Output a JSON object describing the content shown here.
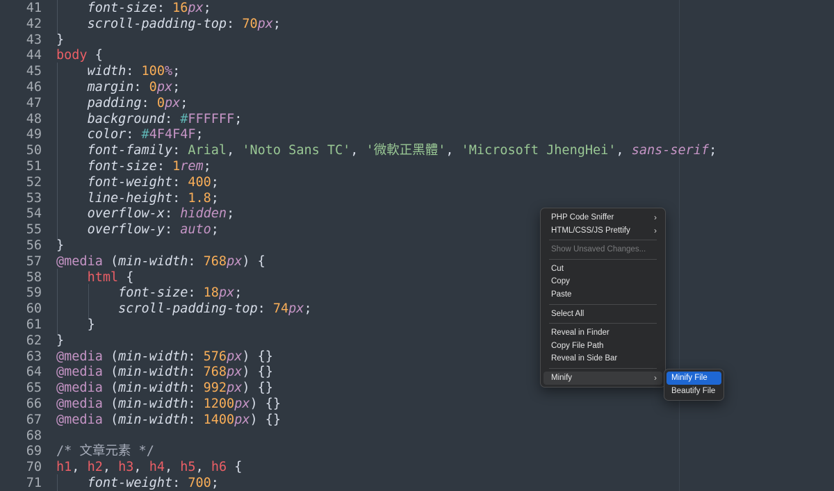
{
  "editor": {
    "lines": [
      {
        "n": "41",
        "segs": [
          [
            "guide",
            "    "
          ],
          [
            "prop",
            "font-size"
          ],
          [
            "punct",
            ": "
          ],
          [
            "num",
            "16"
          ],
          [
            "unit",
            "px"
          ],
          [
            "punct",
            ";"
          ]
        ]
      },
      {
        "n": "42",
        "segs": [
          [
            "guide",
            "    "
          ],
          [
            "prop",
            "scroll-padding-top"
          ],
          [
            "punct",
            ": "
          ],
          [
            "num",
            "70"
          ],
          [
            "unit",
            "px"
          ],
          [
            "punct",
            ";"
          ]
        ]
      },
      {
        "n": "43",
        "segs": [
          [
            "punct",
            "}"
          ]
        ]
      },
      {
        "n": "44",
        "segs": [
          [
            "sel",
            "body"
          ],
          [
            "punct",
            " {"
          ]
        ]
      },
      {
        "n": "45",
        "segs": [
          [
            "guide",
            "    "
          ],
          [
            "prop",
            "width"
          ],
          [
            "punct",
            ": "
          ],
          [
            "num",
            "100"
          ],
          [
            "unit",
            "%"
          ],
          [
            "punct",
            ";"
          ]
        ]
      },
      {
        "n": "46",
        "segs": [
          [
            "guide",
            "    "
          ],
          [
            "prop",
            "margin"
          ],
          [
            "punct",
            ": "
          ],
          [
            "num",
            "0"
          ],
          [
            "unit",
            "px"
          ],
          [
            "punct",
            ";"
          ]
        ]
      },
      {
        "n": "47",
        "segs": [
          [
            "guide",
            "    "
          ],
          [
            "prop",
            "padding"
          ],
          [
            "punct",
            ": "
          ],
          [
            "num",
            "0"
          ],
          [
            "unit",
            "px"
          ],
          [
            "punct",
            ";"
          ]
        ]
      },
      {
        "n": "48",
        "segs": [
          [
            "guide",
            "    "
          ],
          [
            "prop",
            "background"
          ],
          [
            "punct",
            ": "
          ],
          [
            "hash",
            "#"
          ],
          [
            "hex",
            "FFFFFF"
          ],
          [
            "punct",
            ";"
          ]
        ]
      },
      {
        "n": "49",
        "segs": [
          [
            "guide",
            "    "
          ],
          [
            "prop",
            "color"
          ],
          [
            "punct",
            ": "
          ],
          [
            "hash",
            "#"
          ],
          [
            "hex",
            "4F4F4F"
          ],
          [
            "punct",
            ";"
          ]
        ]
      },
      {
        "n": "50",
        "segs": [
          [
            "guide",
            "    "
          ],
          [
            "prop",
            "font-family"
          ],
          [
            "punct",
            ": "
          ],
          [
            "str",
            "Arial"
          ],
          [
            "punct",
            ", "
          ],
          [
            "str",
            "'Noto Sans TC'"
          ],
          [
            "punct",
            ", "
          ],
          [
            "str",
            "'微軟正黑體'"
          ],
          [
            "punct",
            ", "
          ],
          [
            "str",
            "'Microsoft JhengHei'"
          ],
          [
            "punct",
            ", "
          ],
          [
            "kw",
            "sans-serif"
          ],
          [
            "punct",
            ";"
          ]
        ]
      },
      {
        "n": "51",
        "segs": [
          [
            "guide",
            "    "
          ],
          [
            "prop",
            "font-size"
          ],
          [
            "punct",
            ": "
          ],
          [
            "num",
            "1"
          ],
          [
            "unit",
            "rem"
          ],
          [
            "punct",
            ";"
          ]
        ]
      },
      {
        "n": "52",
        "segs": [
          [
            "guide",
            "    "
          ],
          [
            "prop",
            "font-weight"
          ],
          [
            "punct",
            ": "
          ],
          [
            "num",
            "400"
          ],
          [
            "punct",
            ";"
          ]
        ]
      },
      {
        "n": "53",
        "segs": [
          [
            "guide",
            "    "
          ],
          [
            "prop",
            "line-height"
          ],
          [
            "punct",
            ": "
          ],
          [
            "num",
            "1.8"
          ],
          [
            "punct",
            ";"
          ]
        ]
      },
      {
        "n": "54",
        "segs": [
          [
            "guide",
            "    "
          ],
          [
            "prop",
            "overflow-x"
          ],
          [
            "punct",
            ": "
          ],
          [
            "kw",
            "hidden"
          ],
          [
            "punct",
            ";"
          ]
        ]
      },
      {
        "n": "55",
        "segs": [
          [
            "guide",
            "    "
          ],
          [
            "prop",
            "overflow-y"
          ],
          [
            "punct",
            ": "
          ],
          [
            "kw",
            "auto"
          ],
          [
            "punct",
            ";"
          ]
        ]
      },
      {
        "n": "56",
        "segs": [
          [
            "punct",
            "}"
          ]
        ]
      },
      {
        "n": "57",
        "segs": [
          [
            "at",
            "@media"
          ],
          [
            "punct",
            " ("
          ],
          [
            "prop",
            "min-width"
          ],
          [
            "punct",
            ": "
          ],
          [
            "num",
            "768"
          ],
          [
            "unit",
            "px"
          ],
          [
            "punct",
            ") {"
          ]
        ]
      },
      {
        "n": "58",
        "segs": [
          [
            "guide",
            "    "
          ],
          [
            "sel",
            "html"
          ],
          [
            "punct",
            " {"
          ]
        ]
      },
      {
        "n": "59",
        "segs": [
          [
            "guide",
            "    "
          ],
          [
            "guide",
            "    "
          ],
          [
            "prop",
            "font-size"
          ],
          [
            "punct",
            ": "
          ],
          [
            "num",
            "18"
          ],
          [
            "unit",
            "px"
          ],
          [
            "punct",
            ";"
          ]
        ]
      },
      {
        "n": "60",
        "segs": [
          [
            "guide",
            "    "
          ],
          [
            "guide",
            "    "
          ],
          [
            "prop",
            "scroll-padding-top"
          ],
          [
            "punct",
            ": "
          ],
          [
            "num",
            "74"
          ],
          [
            "unit",
            "px"
          ],
          [
            "punct",
            ";"
          ]
        ]
      },
      {
        "n": "61",
        "segs": [
          [
            "guide",
            "    "
          ],
          [
            "punct",
            "}"
          ]
        ]
      },
      {
        "n": "62",
        "segs": [
          [
            "punct",
            "}"
          ]
        ]
      },
      {
        "n": "63",
        "segs": [
          [
            "at",
            "@media"
          ],
          [
            "punct",
            " ("
          ],
          [
            "prop",
            "min-width"
          ],
          [
            "punct",
            ": "
          ],
          [
            "num",
            "576"
          ],
          [
            "unit",
            "px"
          ],
          [
            "punct",
            ") {}"
          ]
        ]
      },
      {
        "n": "64",
        "segs": [
          [
            "at",
            "@media"
          ],
          [
            "punct",
            " ("
          ],
          [
            "prop",
            "min-width"
          ],
          [
            "punct",
            ": "
          ],
          [
            "num",
            "768"
          ],
          [
            "unit",
            "px"
          ],
          [
            "punct",
            ") {}"
          ]
        ]
      },
      {
        "n": "65",
        "segs": [
          [
            "at",
            "@media"
          ],
          [
            "punct",
            " ("
          ],
          [
            "prop",
            "min-width"
          ],
          [
            "punct",
            ": "
          ],
          [
            "num",
            "992"
          ],
          [
            "unit",
            "px"
          ],
          [
            "punct",
            ") {}"
          ]
        ]
      },
      {
        "n": "66",
        "segs": [
          [
            "at",
            "@media"
          ],
          [
            "punct",
            " ("
          ],
          [
            "prop",
            "min-width"
          ],
          [
            "punct",
            ": "
          ],
          [
            "num",
            "1200"
          ],
          [
            "unit",
            "px"
          ],
          [
            "punct",
            ") {}"
          ]
        ]
      },
      {
        "n": "67",
        "segs": [
          [
            "at",
            "@media"
          ],
          [
            "punct",
            " ("
          ],
          [
            "prop",
            "min-width"
          ],
          [
            "punct",
            ": "
          ],
          [
            "num",
            "1400"
          ],
          [
            "unit",
            "px"
          ],
          [
            "punct",
            ") {}"
          ]
        ]
      },
      {
        "n": "68",
        "segs": []
      },
      {
        "n": "69",
        "segs": [
          [
            "comment",
            "/* 文章元素 */"
          ]
        ]
      },
      {
        "n": "70",
        "segs": [
          [
            "sel",
            "h1"
          ],
          [
            "punct",
            ", "
          ],
          [
            "sel",
            "h2"
          ],
          [
            "punct",
            ", "
          ],
          [
            "sel",
            "h3"
          ],
          [
            "punct",
            ", "
          ],
          [
            "sel",
            "h4"
          ],
          [
            "punct",
            ", "
          ],
          [
            "sel",
            "h5"
          ],
          [
            "punct",
            ", "
          ],
          [
            "sel",
            "h6"
          ],
          [
            "punct",
            " {"
          ]
        ]
      },
      {
        "n": "71",
        "segs": [
          [
            "guide",
            "    "
          ],
          [
            "prop",
            "font-weight"
          ],
          [
            "punct",
            ": "
          ],
          [
            "num",
            "700"
          ],
          [
            "punct",
            ";"
          ]
        ]
      }
    ]
  },
  "context_menu": {
    "items": [
      {
        "type": "item",
        "label": "PHP Code Sniffer",
        "submenu": true,
        "name": "menu-item-php-code-sniffer"
      },
      {
        "type": "item",
        "label": "HTML/CSS/JS Prettify",
        "submenu": true,
        "name": "menu-item-prettify"
      },
      {
        "type": "sep"
      },
      {
        "type": "item",
        "label": "Show Unsaved Changes...",
        "disabled": true,
        "name": "menu-item-show-unsaved-changes"
      },
      {
        "type": "sep"
      },
      {
        "type": "item",
        "label": "Cut",
        "name": "menu-item-cut"
      },
      {
        "type": "item",
        "label": "Copy",
        "name": "menu-item-copy"
      },
      {
        "type": "item",
        "label": "Paste",
        "name": "menu-item-paste"
      },
      {
        "type": "sep"
      },
      {
        "type": "item",
        "label": "Select All",
        "name": "menu-item-select-all"
      },
      {
        "type": "sep"
      },
      {
        "type": "item",
        "label": "Reveal in Finder",
        "name": "menu-item-reveal-in-finder"
      },
      {
        "type": "item",
        "label": "Copy File Path",
        "name": "menu-item-copy-file-path"
      },
      {
        "type": "item",
        "label": "Reveal in Side Bar",
        "name": "menu-item-reveal-in-side-bar"
      },
      {
        "type": "sep"
      },
      {
        "type": "item",
        "label": "Minify",
        "submenu": true,
        "hover": true,
        "name": "menu-item-minify"
      }
    ]
  },
  "submenu": {
    "items": [
      {
        "label": "Minify File",
        "selected": true,
        "name": "submenu-item-minify-file"
      },
      {
        "label": "Beautify File",
        "name": "submenu-item-beautify-file"
      }
    ]
  },
  "icons": {
    "submenu_chevron": "chevron-right-icon"
  }
}
